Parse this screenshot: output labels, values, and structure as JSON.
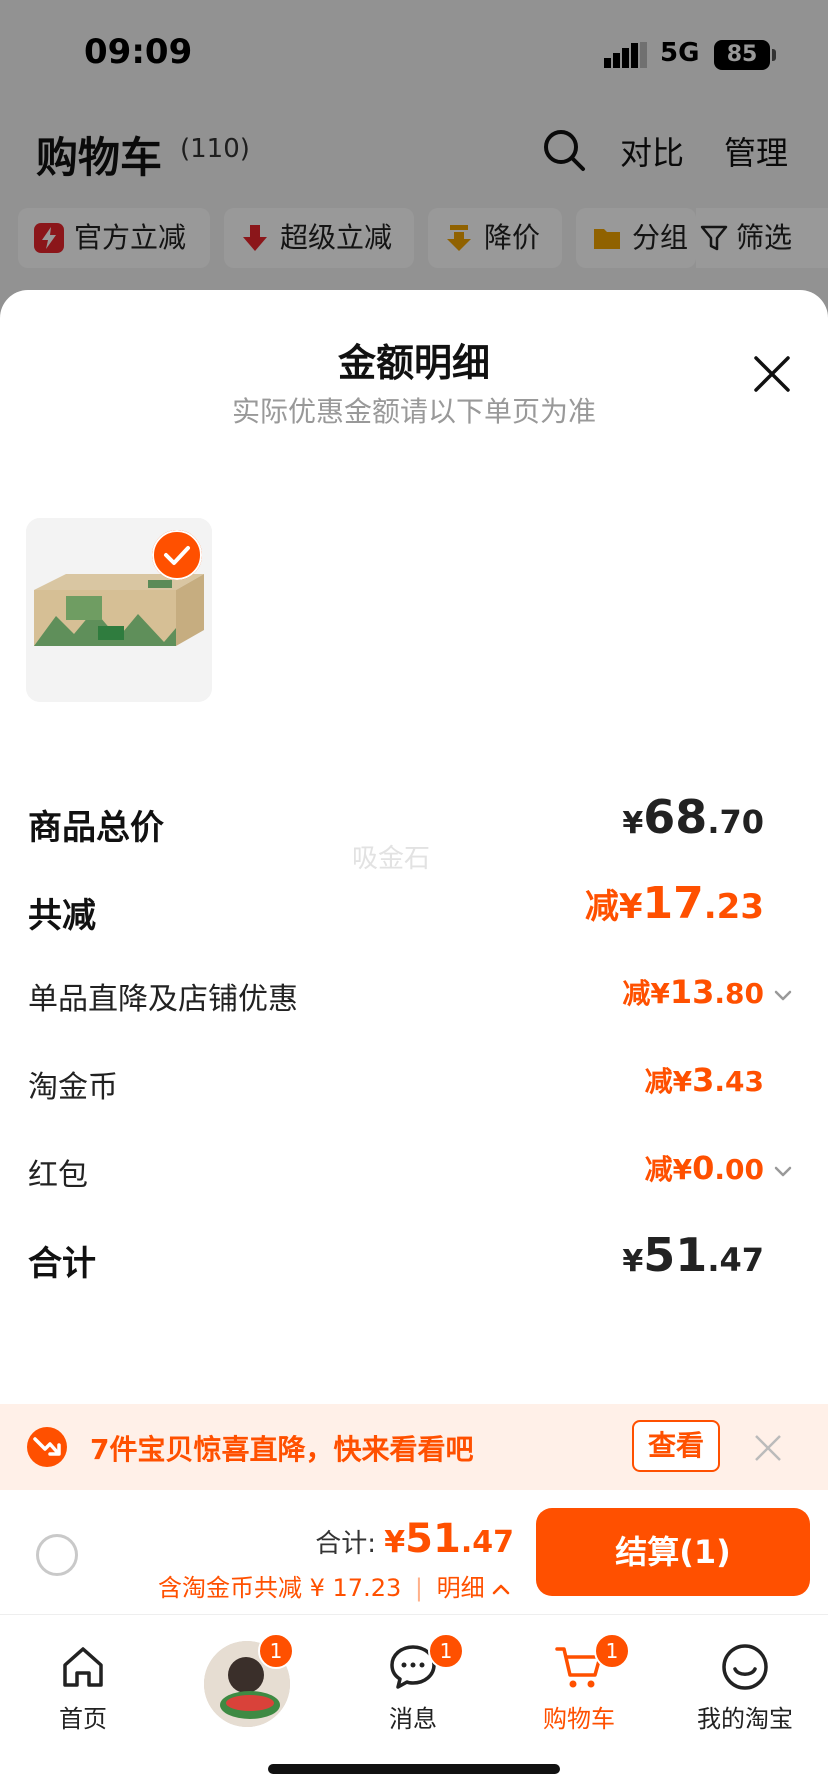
{
  "status_bar": {
    "time": "09:09",
    "network": "5G",
    "battery": "85"
  },
  "cart_header": {
    "title": "购物车",
    "count": "(110)",
    "compare_label": "对比",
    "manage_label": "管理"
  },
  "filters": [
    {
      "label": "官方立减",
      "icon": "flash-icon"
    },
    {
      "label": "超级立减",
      "icon": "arrow-down-icon"
    },
    {
      "label": "降价",
      "icon": "price-drop-icon"
    },
    {
      "label": "分组",
      "icon": "folder-icon"
    }
  ],
  "filter_button": "筛选",
  "sheet": {
    "title": "金额明细",
    "subtitle": "实际优惠金额请以下单页为准",
    "watermark": "吸金石"
  },
  "breakdown": {
    "subtotal": {
      "label": "商品总价",
      "currency": "¥",
      "int": "68",
      "dec": ".70"
    },
    "total_discount": {
      "label": "共减",
      "prefix": "减¥",
      "int": "17",
      "dec": ".23"
    },
    "item_discount": {
      "label": "单品直降及店铺优惠",
      "prefix": "减¥",
      "int": "13",
      "dec": ".80"
    },
    "coins": {
      "label": "淘金币",
      "prefix": "减¥",
      "int": "3",
      "dec": ".43"
    },
    "red_packet": {
      "label": "红包",
      "prefix": "减¥",
      "int": "0",
      "dec": ".00"
    },
    "total": {
      "label": "合计",
      "currency": "¥",
      "int": "51",
      "dec": ".47"
    }
  },
  "promo": {
    "text": "7件宝贝惊喜直降，快来看看吧",
    "button": "查看"
  },
  "checkout": {
    "total_label": "合计: ",
    "currency": "¥",
    "int": "51",
    "dec": ".47",
    "savings": "含淘金币共减 ¥ 17.23",
    "detail_link": "明细",
    "button": "结算(1)"
  },
  "tabbar": [
    {
      "label": "首页",
      "icon": "home-icon",
      "badge": ""
    },
    {
      "label": "",
      "icon": "avatar",
      "badge": "1"
    },
    {
      "label": "消息",
      "icon": "message-icon",
      "badge": "1"
    },
    {
      "label": "购物车",
      "icon": "cart-icon",
      "badge": "1"
    },
    {
      "label": "我的淘宝",
      "icon": "profile-icon",
      "badge": ""
    }
  ],
  "colors": {
    "accent": "#ff5000",
    "promo_bg": "#fff0e8"
  }
}
